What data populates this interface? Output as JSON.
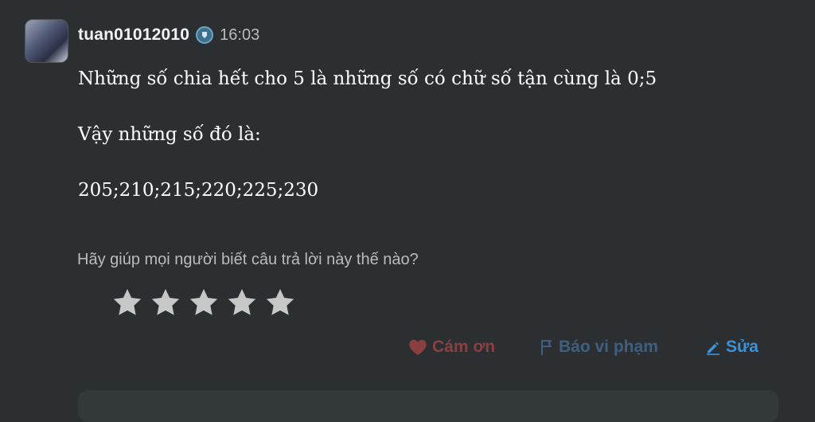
{
  "author": {
    "username": "tuan01012010",
    "time": "16:03"
  },
  "answer": {
    "lines": [
      "Những số chia hết cho 5 là những số có chữ số tận cùng là 0;5",
      "Vậy những số đó là:",
      "205;210;215;220;225;230"
    ]
  },
  "rating": {
    "prompt": "Hãy giúp mọi người biết câu trả lời này thế nào?",
    "stars_total": 5
  },
  "actions": {
    "thanks_label": "Cám ơn",
    "report_label": "Báo vi phạm",
    "edit_label": "Sửa"
  },
  "colors": {
    "background": "#2b2f31",
    "thanks": "#8c3f3f",
    "report": "#3e5f80",
    "edit": "#3e92d8",
    "star": "#c7c7c7"
  }
}
